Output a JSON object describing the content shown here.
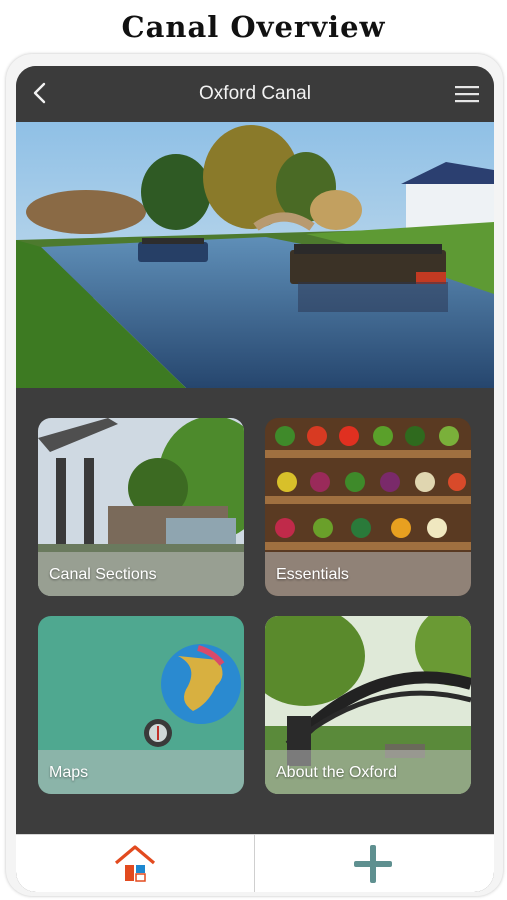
{
  "page_heading": "Canal Overview",
  "app_bar": {
    "title": "Oxford Canal",
    "back_icon": "chevron-left-icon",
    "menu_icon": "hamburger-menu-icon"
  },
  "hero_image": {
    "subject": "canal-with-narrowboats-photo"
  },
  "tiles": [
    {
      "label": "Canal Sections",
      "image": "canal-lift-bridge-photo"
    },
    {
      "label": "Essentials",
      "image": "grocery-shelves-photo"
    },
    {
      "label": "Maps",
      "image": "globe-and-compass-photo"
    },
    {
      "label": "About the Oxford",
      "image": "iron-bridge-photo"
    }
  ],
  "bottom_nav": {
    "home_icon": "home-icon",
    "add_icon": "plus-icon"
  },
  "colors": {
    "screen_bg": "#3d3d3d",
    "app_bar_bg": "#3b3b3b",
    "home_icon_roof": "#e24a1f",
    "home_icon_door": "#1e88d0",
    "plus_icon": "#5f9090"
  }
}
